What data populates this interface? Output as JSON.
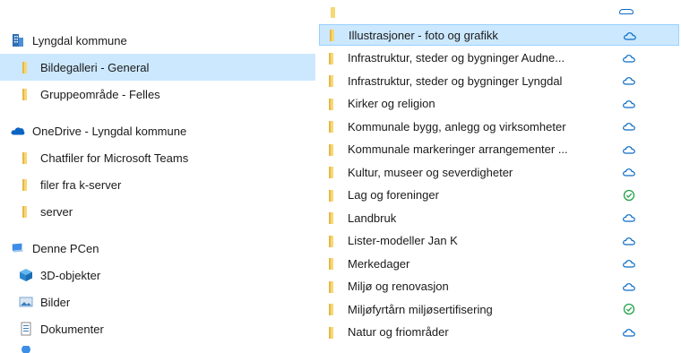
{
  "nav": {
    "items": [
      {
        "label": "Lyngdal kommune",
        "icon": "building-icon"
      },
      {
        "label": "Bildegalleri - General",
        "icon": "folder-icon",
        "selected": true
      },
      {
        "label": "Gruppeområde - Felles",
        "icon": "folder-icon"
      },
      {
        "label": "OneDrive - Lyngdal kommune",
        "icon": "onedrive-cloud-icon"
      },
      {
        "label": "Chatfiler for Microsoft Teams",
        "icon": "folder-icon"
      },
      {
        "label": "filer fra k-server",
        "icon": "folder-icon"
      },
      {
        "label": "server",
        "icon": "folder-icon"
      },
      {
        "label": "Denne PCen",
        "icon": "computer-icon"
      },
      {
        "label": "3D-objekter",
        "icon": "3d-objects-icon"
      },
      {
        "label": "Bilder",
        "icon": "pictures-icon"
      },
      {
        "label": "Dokumenter",
        "icon": "documents-icon"
      }
    ]
  },
  "files": {
    "items": [
      {
        "name": "Illustrasjoner - foto og grafikk",
        "status": "cloud",
        "selected": true
      },
      {
        "name": "Infrastruktur, steder og bygninger Audne...",
        "status": "cloud"
      },
      {
        "name": "Infrastruktur, steder og bygninger Lyngdal",
        "status": "cloud"
      },
      {
        "name": "Kirker og religion",
        "status": "cloud"
      },
      {
        "name": "Kommunale bygg, anlegg og virksomheter",
        "status": "cloud"
      },
      {
        "name": "Kommunale markeringer arrangementer ...",
        "status": "cloud"
      },
      {
        "name": "Kultur, museer og severdigheter",
        "status": "cloud"
      },
      {
        "name": "Lag og foreninger",
        "status": "synced"
      },
      {
        "name": "Landbruk",
        "status": "cloud"
      },
      {
        "name": "Lister-modeller Jan K",
        "status": "cloud"
      },
      {
        "name": "Merkedager",
        "status": "cloud"
      },
      {
        "name": "Miljø og renovasjon",
        "status": "cloud"
      },
      {
        "name": "Miljøfyrtårn miljøsertifisering",
        "status": "synced"
      },
      {
        "name": "Natur og friområder",
        "status": "cloud"
      }
    ]
  },
  "colors": {
    "selection": "#cce8ff",
    "folder": "#f8d775",
    "cloud_status": "#0b6cc4",
    "synced_status": "#22a34a"
  }
}
